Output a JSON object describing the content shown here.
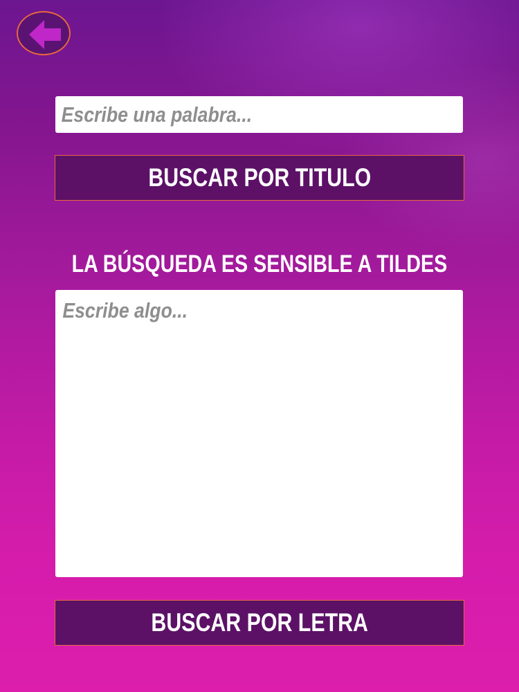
{
  "header": {
    "back_button_icon": "arrow-left-icon",
    "accent_color": "#c027c8"
  },
  "title_search": {
    "placeholder": "Escribe una palabra...",
    "value": "",
    "button_label": "BUSCAR POR TITULO"
  },
  "notice_text": "LA BÚSQUEDA ES SENSIBLE A TILDES",
  "lyrics_search": {
    "placeholder": "Escribe algo...",
    "value": "",
    "button_label": "BUSCAR POR LETRA"
  },
  "colors": {
    "button_bg": "#5c1167",
    "button_border": "#e7673f",
    "background_top": "#6c1690",
    "background_bottom": "#dd1ead"
  }
}
